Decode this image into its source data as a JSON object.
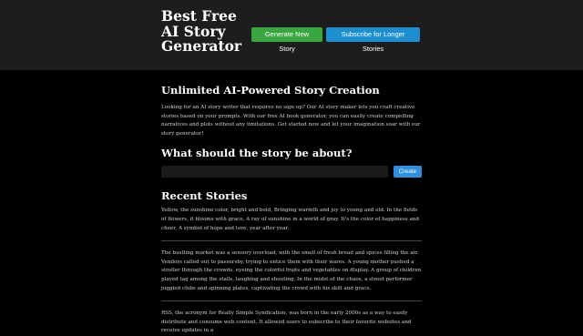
{
  "header": {
    "title": "Best Free AI Story Generator",
    "generate_label": "Generate New Story",
    "subscribe_label": "Subscribe for Longer Stories"
  },
  "main": {
    "heading": "Unlimited AI-Powered Story Creation",
    "intro": "Looking for an AI story writer that requires no sign up? Our AI story maker lets you craft creative stories based on your prompts. With our free AI book generator, you can easily create compelling narratives and plots without any limitations. Get started now and let your imagination soar with our story generator!",
    "prompt_heading": "What should the story be about?",
    "prompt_value": "",
    "create_label": "Create",
    "recent_heading": "Recent Stories",
    "stories": [
      "Yellow, the sunshine color, bright and bold, Bringing warmth and joy to young and old. In the fields of flowers, it blooms with grace, A ray of sunshine in a world of gray. It's the color of happiness and cheer, A symbol of hope and love, year after year.",
      "The bustling market was a sensory overload, with the smell of fresh bread and spices filling the air. Vendors called out to passersby, trying to entice them with their wares. A young mother pushed a stroller through the crowds, eyeing the colorful fruits and vegetables on display. A group of children played tag among the stalls, laughing and shouting. In the midst of the chaos, a street performer juggled clubs and spinning plates, captivating the crowd with his skill and grace.",
      "RSS, the acronym for Really Simple Syndication, was born in the early 2000s as a way to easily distribute and consume web content. It allowed users to subscribe to their favorite websites and receive updates in a"
    ]
  }
}
